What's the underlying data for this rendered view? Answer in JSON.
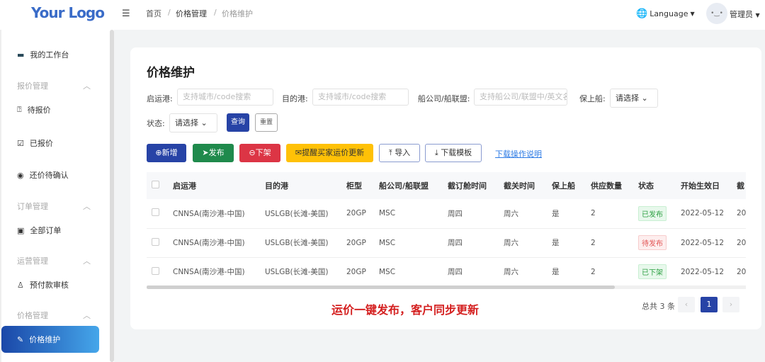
{
  "header": {
    "logo": "Your Logo",
    "breadcrumb": [
      "首页",
      "价格管理",
      "价格维护"
    ],
    "language": "Language",
    "user": "管理员"
  },
  "sidebar": {
    "workbench": "我的工作台",
    "groups": [
      {
        "label": "报价管理",
        "items": [
          "待报价",
          "已报价",
          "还价待确认"
        ]
      },
      {
        "label": "订单管理",
        "items": [
          "全部订单"
        ]
      },
      {
        "label": "运营管理",
        "items": [
          "预付款审核"
        ]
      },
      {
        "label": "价格管理",
        "items": [
          "价格维护"
        ]
      }
    ],
    "active": "价格维护"
  },
  "page": {
    "title": "价格维护"
  },
  "filters": {
    "origin_label": "启运港:",
    "origin_placeholder": "支持城市/code搜索",
    "dest_label": "目的港:",
    "dest_placeholder": "支持城市/code搜索",
    "carrier_label": "船公司/船联盟:",
    "carrier_placeholder": "支持船公司/联盟中/英文名",
    "guarantee_label": "保上船:",
    "guarantee_value": "请选择",
    "status_label": "状态:",
    "status_value": "请选择",
    "query": "查询",
    "reset": "重置"
  },
  "actions": {
    "add": "新增",
    "publish": "发布",
    "unpublish": "下架",
    "remind": "提醒买家运价更新",
    "import": "导入",
    "template": "下载模板",
    "help": "下载操作说明"
  },
  "colors": {
    "primary": "#2743a6",
    "green": "#1f8a4c",
    "red": "#dc3545",
    "yellow": "#ffc107",
    "link": "#2d7be5"
  },
  "table": {
    "columns": [
      "启运港",
      "目的港",
      "柜型",
      "船公司/船联盟",
      "截订舱时间",
      "截关时间",
      "保上船",
      "供应数量",
      "状态",
      "开始生效日",
      "截"
    ],
    "rows": [
      {
        "origin": "CNNSA(南沙港-中国)",
        "dest": "USLGB(长滩-美国)",
        "type": "20GP",
        "carrier": "MSC",
        "booking": "周四",
        "cutoff": "周六",
        "guarantee": "是",
        "qty": "2",
        "status": "已发布",
        "start": "2022-05-12",
        "more": "20"
      },
      {
        "origin": "CNNSA(南沙港-中国)",
        "dest": "USLGB(长滩-美国)",
        "type": "20GP",
        "carrier": "MSC",
        "booking": "周四",
        "cutoff": "周六",
        "guarantee": "是",
        "qty": "2",
        "status": "待发布",
        "start": "2022-05-12",
        "more": "20"
      },
      {
        "origin": "CNNSA(南沙港-中国)",
        "dest": "USLGB(长滩-美国)",
        "type": "20GP",
        "carrier": "MSC",
        "booking": "周四",
        "cutoff": "周六",
        "guarantee": "是",
        "qty": "2",
        "status": "已下架",
        "start": "2022-05-12",
        "more": "20"
      }
    ]
  },
  "footer": {
    "note": "运价一键发布，客户同步更新",
    "total": "总共 3 条",
    "page": "1",
    "prev": "‹",
    "next": "›"
  }
}
